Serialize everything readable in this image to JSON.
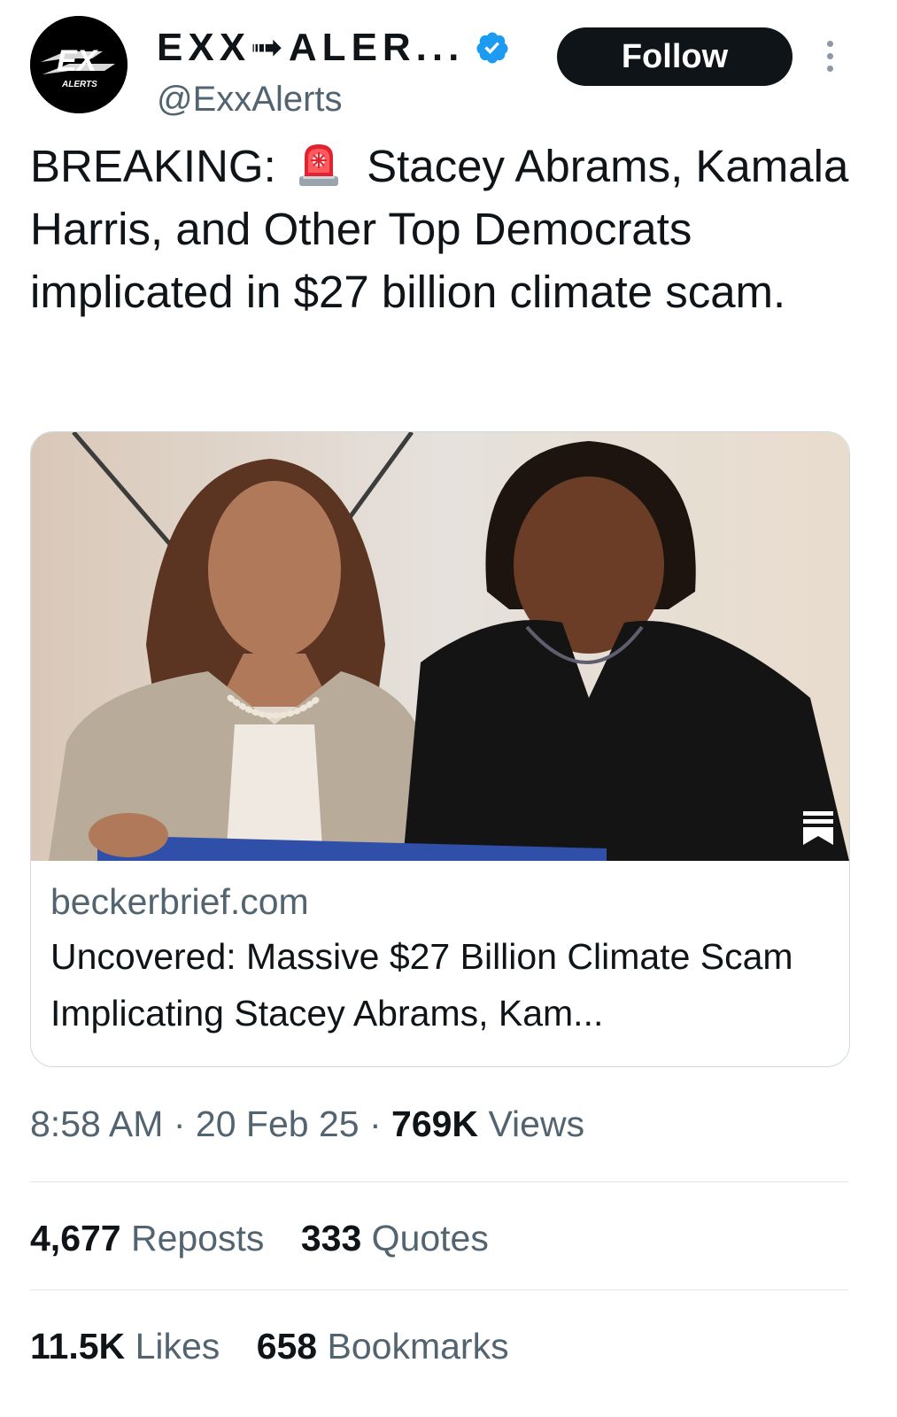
{
  "author": {
    "display_name": "EXX➟ALER...",
    "handle": "@ExxAlerts",
    "avatar_text": "EX",
    "avatar_subtext": "ALERTS",
    "verified": true,
    "verified_color": "#1d9bf0",
    "follow_label": "Follow"
  },
  "post": {
    "text_before_emoji": "BREAKING:",
    "emoji": "police-car-light",
    "text_after_emoji": "Stacey Abrams, Kamala Harris, and Other Top Democrats implicated in $27 billion climate scam."
  },
  "link_card": {
    "domain": "beckerbrief.com",
    "title": "Uncovered: Massive $27 Billion Climate Scam Implicating Stacey Abrams, Kam..."
  },
  "meta": {
    "time": "8:58 AM",
    "sep1": "·",
    "date": "20 Feb 25",
    "sep2": "·",
    "views_count": "769K",
    "views_label": "Views"
  },
  "stats": {
    "reposts_count": "4,677",
    "reposts_label": "Reposts",
    "quotes_count": "333",
    "quotes_label": "Quotes",
    "likes_count": "11.5K",
    "likes_label": "Likes",
    "bookmarks_count": "658",
    "bookmarks_label": "Bookmarks"
  },
  "colors": {
    "text_primary": "#0f1419",
    "text_secondary": "#536471",
    "follow_bg": "#0f1419",
    "border": "#cfd9de"
  }
}
